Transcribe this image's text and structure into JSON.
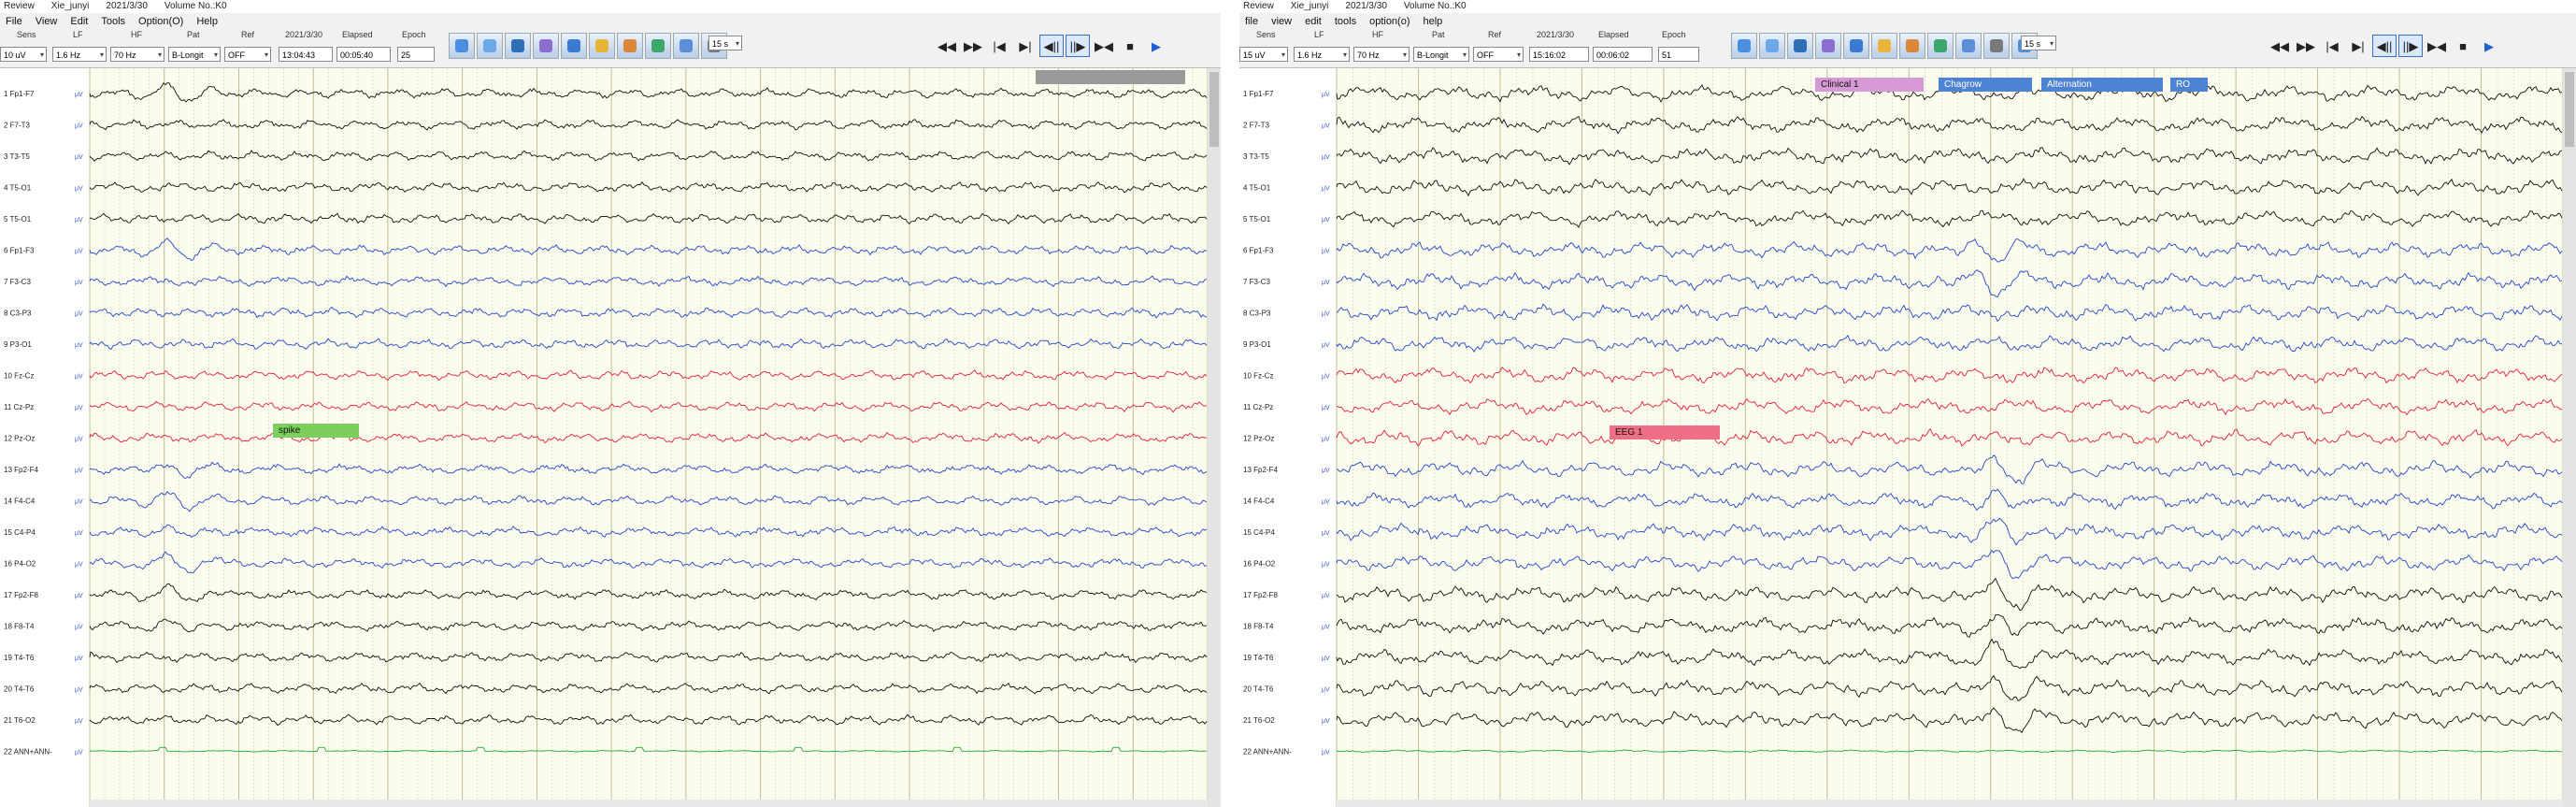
{
  "left": {
    "title": {
      "app": "Review",
      "patient": "Xie_junyi",
      "date": "2021/3/30",
      "volume": "Volume No.:K0"
    },
    "menu": [
      "File",
      "View",
      "Edit",
      "Tools",
      "Option(O)",
      "Help"
    ],
    "toolbar": {
      "labels": [
        "Sens",
        "LF",
        "HF",
        "Pat",
        "Ref",
        "2021/3/30",
        "Elapsed",
        "Epoch"
      ],
      "values": [
        "10 uV",
        "1.6 Hz",
        "70 Hz",
        "B-Longit",
        "OFF",
        "13:04:43",
        "00:05:40",
        "25"
      ],
      "time_window": "15 s"
    },
    "channels": [
      "1 Fp1-F7",
      "2 F7-T3",
      "3 T3-T5",
      "4 T5-O1",
      "5 T5-O1",
      "6 Fp1-F3",
      "7 F3-C3",
      "8 C3-P3",
      "9 P3-O1",
      "10 Fz-Cz",
      "11 Cz-Pz",
      "12 Pz-Oz",
      "13 Fp2-F4",
      "14 F4-C4",
      "15 C4-P4",
      "16 P4-O2",
      "17 Fp2-F8",
      "18 F8-T4",
      "19 T4-T6",
      "20 T4-T6",
      "21 T6-O2",
      "22 ANN+ANN-"
    ],
    "unit": "μV",
    "annotations": [
      {
        "text": "spike",
        "color": "green"
      },
      {
        "text": "",
        "color": "gray"
      }
    ]
  },
  "right": {
    "title": {
      "app": "Review",
      "patient": "Xie_junyi",
      "date": "2021/3/30",
      "volume": "Volume No.:K0"
    },
    "menu": [
      "file",
      "view",
      "edit",
      "tools",
      "option(o)",
      "help"
    ],
    "toolbar": {
      "labels": [
        "Sens",
        "LF",
        "HF",
        "Pat",
        "Ref",
        "2021/3/30",
        "Elapsed",
        "Epoch"
      ],
      "values": [
        "15 uV",
        "1.6 Hz",
        "70 Hz",
        "B-Longit",
        "OFF",
        "15:16:02",
        "00:06:02",
        "51"
      ],
      "time_window": "15 s"
    },
    "channels": [
      "1 Fp1-F7",
      "2 F7-T3",
      "3 T3-T5",
      "4 T5-O1",
      "5 T5-O1",
      "6 Fp1-F3",
      "7 F3-C3",
      "8 C3-P3",
      "9 P3-O1",
      "10 Fz-Cz",
      "11 Cz-Pz",
      "12 Pz-Oz",
      "13 Fp2-F4",
      "14 F4-C4",
      "15 C4-P4",
      "16 P4-O2",
      "17 Fp2-F8",
      "18 F8-T4",
      "19 T4-T6",
      "20 T4-T6",
      "21 T6-O2",
      "22 ANN+ANN-"
    ],
    "unit": "μV",
    "annotations": [
      {
        "text": "Clinical 1",
        "color": "magenta"
      },
      {
        "text": "Chagrow",
        "color": "blue"
      },
      {
        "text": "Alternation",
        "color": "blue"
      },
      {
        "text": "RO",
        "color": "blue"
      },
      {
        "text": "EEG 1",
        "color": "red"
      }
    ]
  },
  "colors": {
    "black": "#111111",
    "blue": "#2648c8",
    "red": "#e0203a",
    "green": "#22aa33",
    "plot_bg": "#fbfbee",
    "grid": "#c9c9a6"
  }
}
